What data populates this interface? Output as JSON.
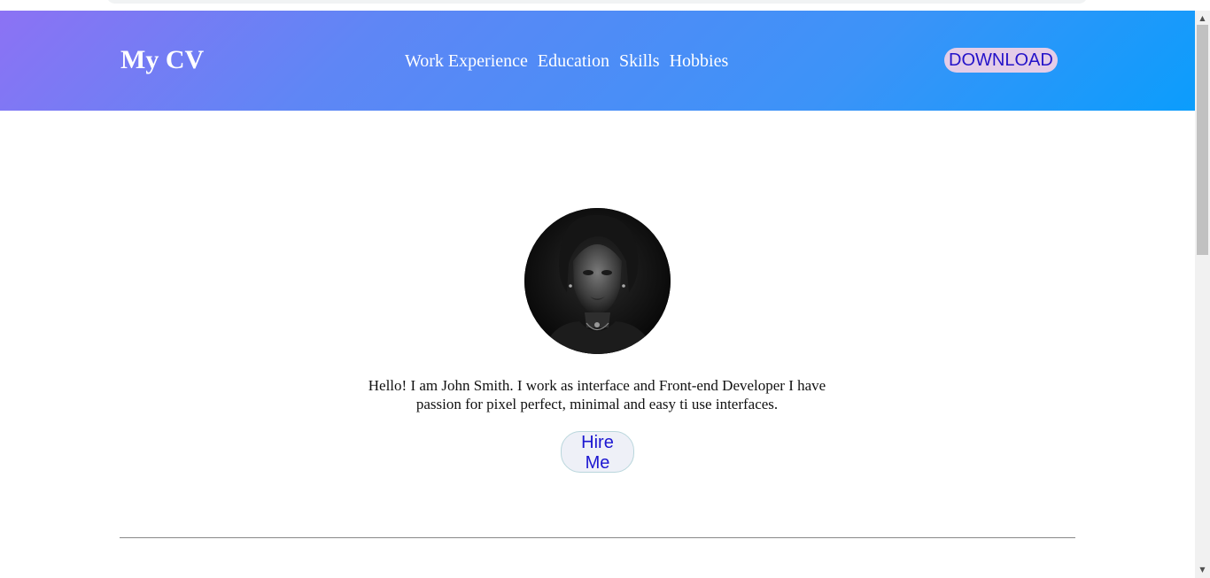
{
  "header": {
    "brand": "My CV",
    "nav": [
      "Work Experience",
      "Education",
      "Skills",
      "Hobbies"
    ],
    "download_label": "DOWNLOAD"
  },
  "hero": {
    "intro": "Hello! I am John Smith. I work as interface and Front-end Developer I have passion for pixel perfect, minimal and easy ti use interfaces.",
    "hire_label": "Hire Me"
  },
  "icons": {
    "scroll_up": "scroll-up-arrow-icon",
    "scroll_down": "scroll-down-arrow-icon"
  },
  "colors": {
    "header_gradient_start": "#8c72f4",
    "header_gradient_end": "#0b9dfc",
    "download_bg": "#e4cde8",
    "download_text": "#2513c9",
    "hire_text": "#1c17d1"
  }
}
